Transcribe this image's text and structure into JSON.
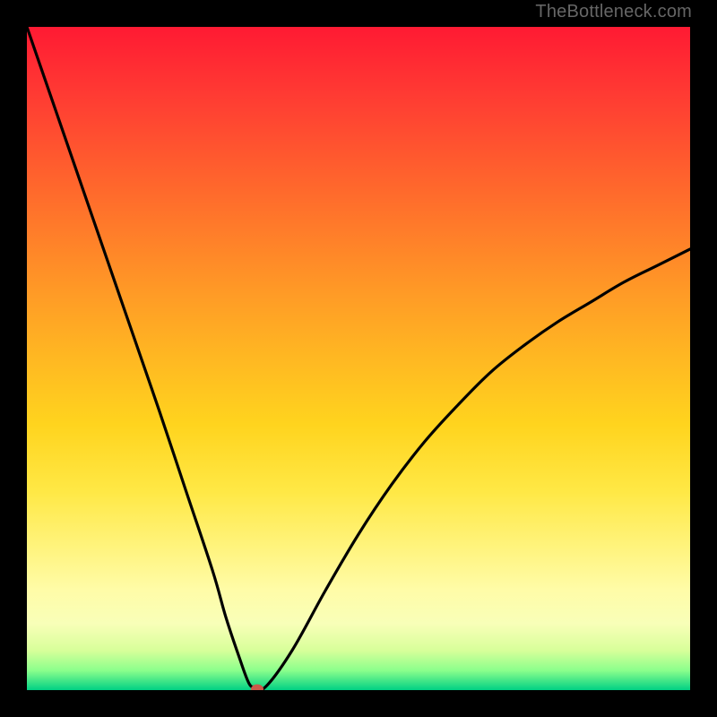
{
  "watermark": "TheBottleneck.com",
  "chart_data": {
    "type": "line",
    "title": "",
    "xlabel": "",
    "ylabel": "",
    "xlim": [
      0,
      1
    ],
    "ylim": [
      0,
      1
    ],
    "grid": false,
    "legend": false,
    "gradient_colors_top_to_bottom": [
      "#ff1a33",
      "#ff3a33",
      "#ff5a2e",
      "#ff7a2a",
      "#ff9a26",
      "#ffb822",
      "#ffd41e",
      "#ffe845",
      "#fff37a",
      "#fffca8",
      "#f8ffb8",
      "#d8ff9a",
      "#8cff8c",
      "#00d084"
    ],
    "series": [
      {
        "name": "curve",
        "x": [
          0.0,
          0.05,
          0.1,
          0.15,
          0.2,
          0.24,
          0.28,
          0.3,
          0.32,
          0.335,
          0.345,
          0.36,
          0.4,
          0.45,
          0.5,
          0.55,
          0.6,
          0.65,
          0.7,
          0.75,
          0.8,
          0.85,
          0.9,
          0.95,
          1.0
        ],
        "y": [
          1.0,
          0.855,
          0.71,
          0.565,
          0.42,
          0.3,
          0.18,
          0.11,
          0.05,
          0.01,
          0.005,
          0.005,
          0.06,
          0.15,
          0.235,
          0.31,
          0.375,
          0.43,
          0.48,
          0.52,
          0.555,
          0.585,
          0.615,
          0.64,
          0.665
        ]
      }
    ],
    "marker": {
      "x": 0.347,
      "y": 0.002,
      "color": "#cc5a4a"
    }
  }
}
